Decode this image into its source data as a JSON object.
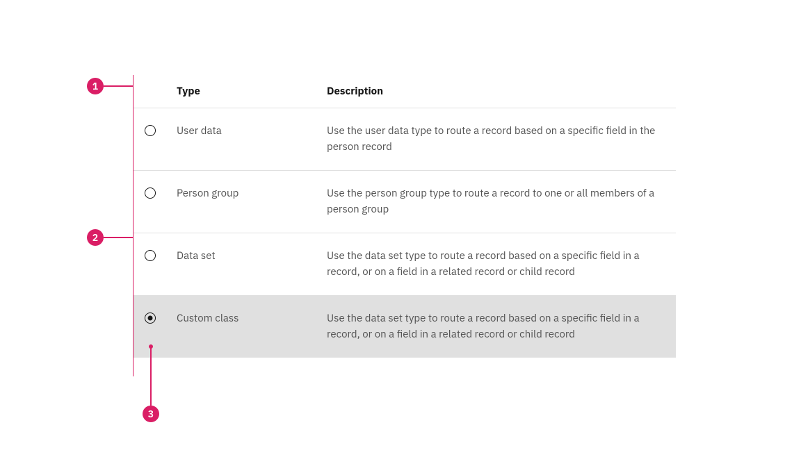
{
  "callouts": {
    "c1": "1",
    "c2": "2",
    "c3": "3"
  },
  "headers": {
    "type": "Type",
    "description": "Description"
  },
  "rows": [
    {
      "type": "User data",
      "description": "Use the user data type to route a record based on a specific field in the person record",
      "selected": false
    },
    {
      "type": "Person group",
      "description": "Use the person group type to route a record to one or all members of a person group",
      "selected": false
    },
    {
      "type": "Data set",
      "description": "Use the data set type to route a record based on a specific field in a record, or on a field in a related record or child record",
      "selected": false
    },
    {
      "type": "Custom class",
      "description": "Use the data set type to route a record based on a specific field in a record, or on a field in a related record or child record",
      "selected": true
    }
  ]
}
